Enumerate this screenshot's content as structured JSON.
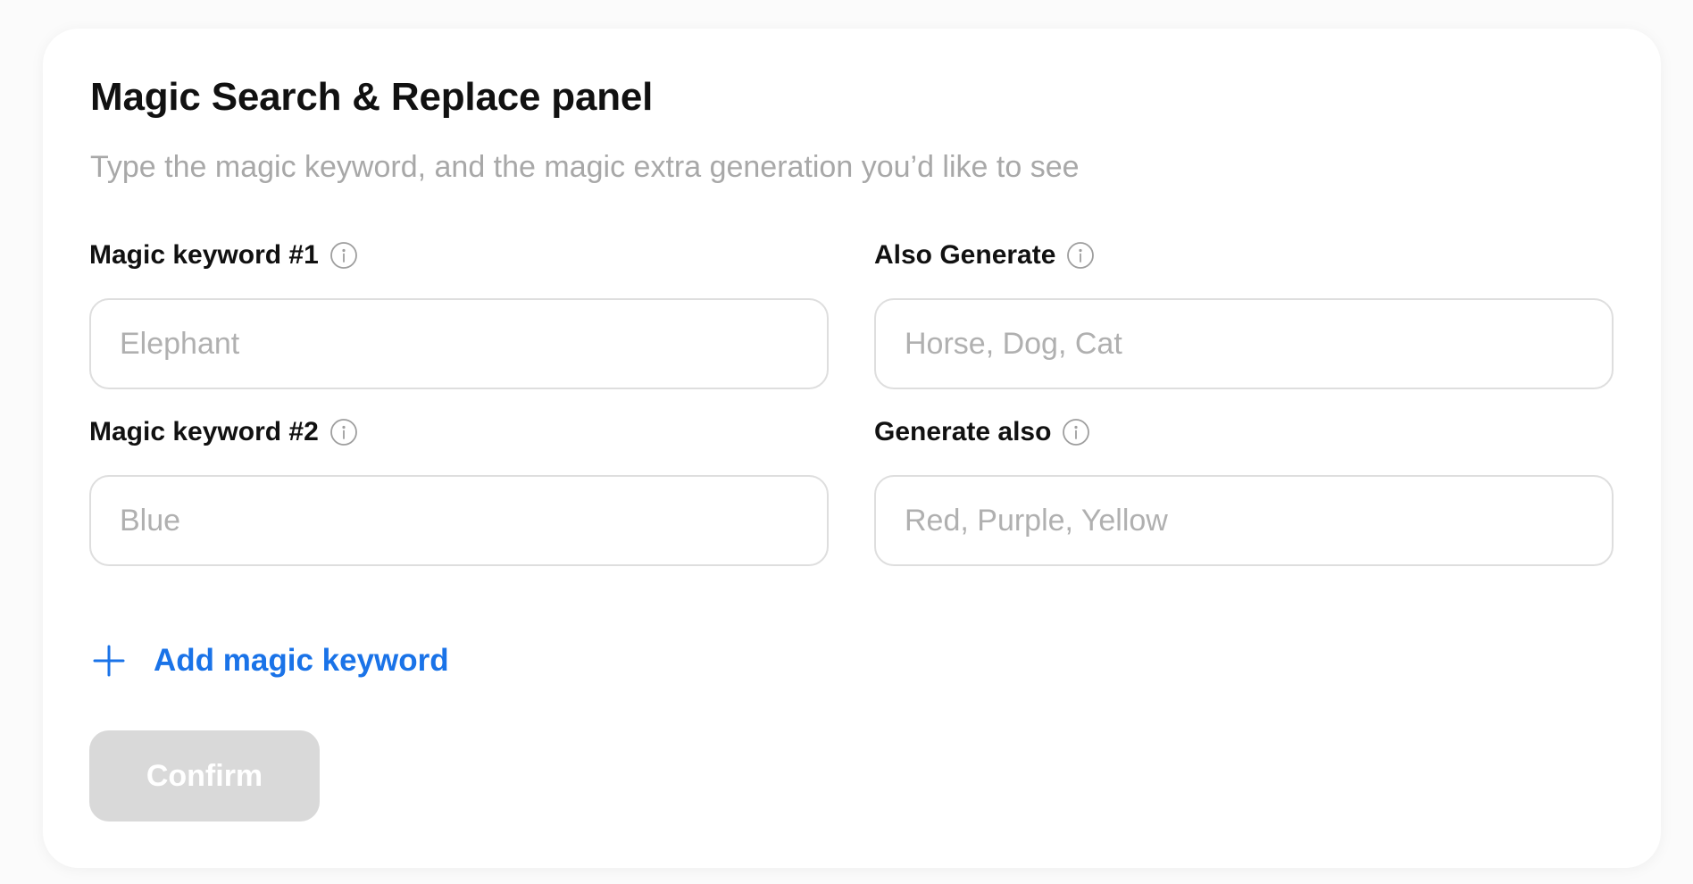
{
  "panel": {
    "title": "Magic Search & Replace panel",
    "subtitle": "Type the magic keyword, and the magic extra generation you’d like to see"
  },
  "fields": [
    {
      "label": "Magic keyword #1",
      "placeholder": "Elephant",
      "value": "",
      "icon": "info-icon"
    },
    {
      "label": "Also Generate",
      "placeholder": "Horse, Dog, Cat",
      "value": "",
      "icon": "info-icon"
    },
    {
      "label": "Magic keyword #2",
      "placeholder": "Blue",
      "value": "",
      "icon": "info-icon"
    },
    {
      "label": "Generate also",
      "placeholder": "Red, Purple, Yellow",
      "value": "",
      "icon": "info-icon"
    }
  ],
  "add_keyword": {
    "label": "Add magic keyword",
    "icon": "plus-icon"
  },
  "confirm": {
    "label": "Confirm",
    "state": "disabled"
  },
  "colors": {
    "accent": "#1a73e8",
    "title": "#111111",
    "subtitle": "#a8a8a8",
    "input_border": "#dedede",
    "placeholder": "#b0b0b0",
    "button_disabled_bg": "#d9d9d9",
    "button_text": "#ffffff",
    "icon_gray": "#9e9e9e"
  }
}
